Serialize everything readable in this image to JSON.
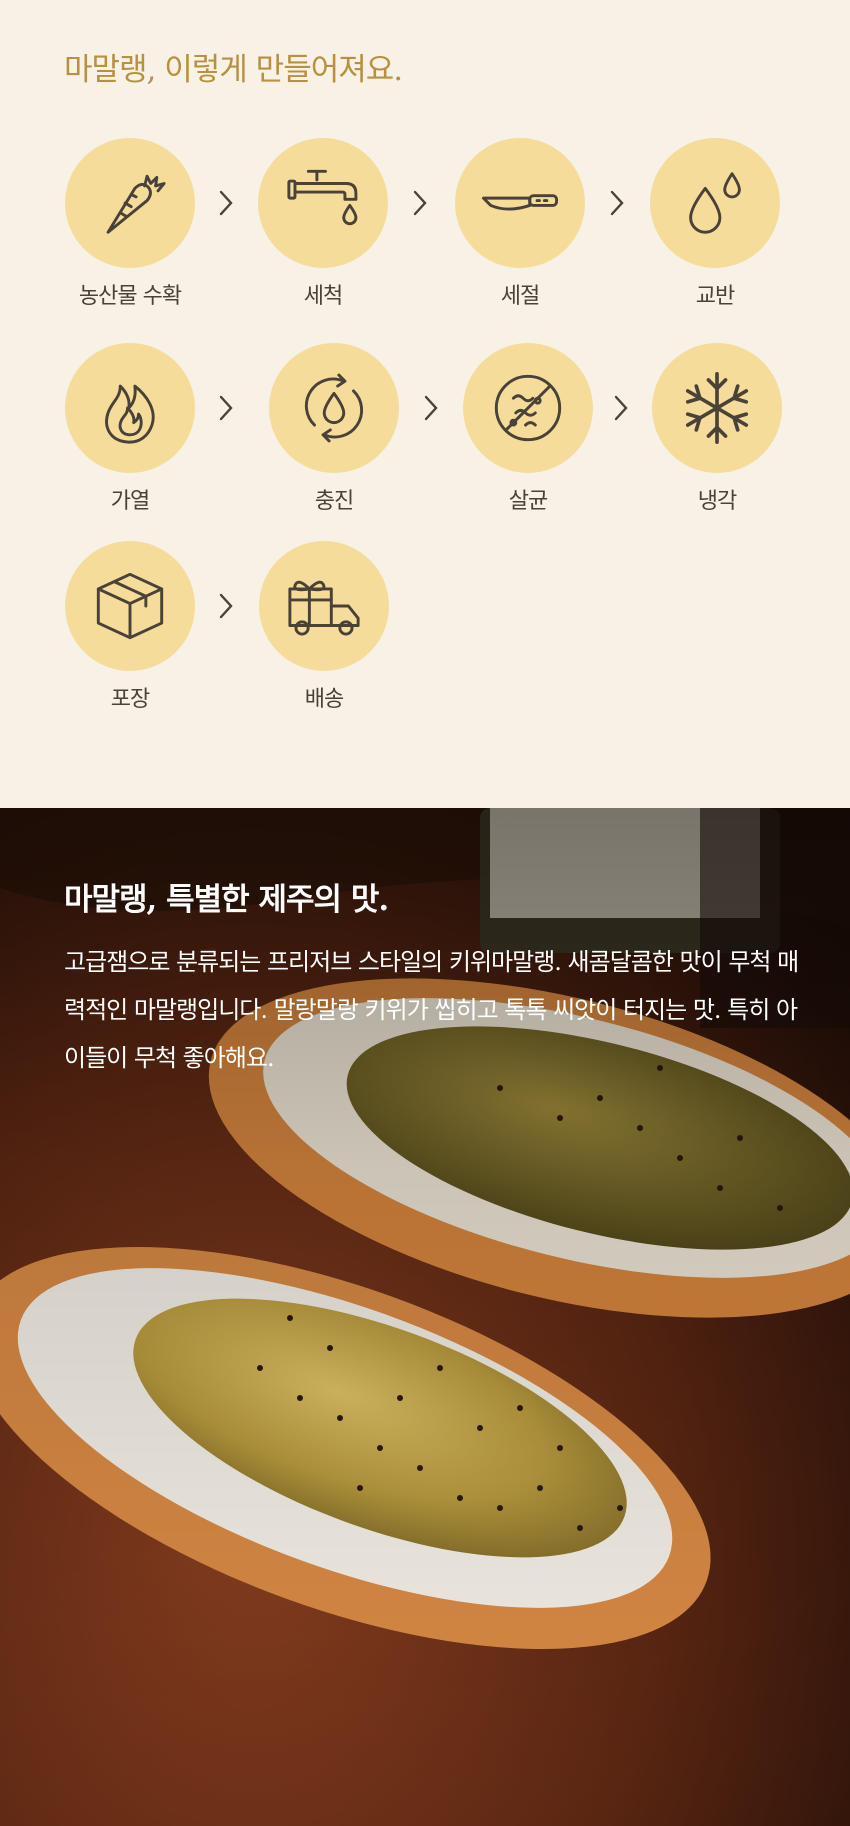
{
  "process": {
    "title": "마말랭, 이렇게 만들어져요.",
    "steps": [
      {
        "label": "농산물 수확",
        "icon": "carrot-icon"
      },
      {
        "label": "세척",
        "icon": "faucet-icon"
      },
      {
        "label": "세절",
        "icon": "knife-icon"
      },
      {
        "label": "교반",
        "icon": "droplets-icon"
      },
      {
        "label": "가열",
        "icon": "flame-icon"
      },
      {
        "label": "충진",
        "icon": "refill-cycle-icon"
      },
      {
        "label": "살균",
        "icon": "no-germs-icon"
      },
      {
        "label": "냉각",
        "icon": "snowflake-icon"
      },
      {
        "label": "포장",
        "icon": "box-icon"
      },
      {
        "label": "배송",
        "icon": "gift-truck-icon"
      }
    ],
    "arrow_icon": "chevron-right-icon"
  },
  "story": {
    "title": "마말랭, 특별한 제주의 맛.",
    "body": "고급잼으로 분류되는 프리저브 스타일의 키위마말랭. 새콤달콤한 맛이 무척 매력적인 마말랭입니다. 말랑말랑 키위가 씹히고 톡톡 씨앗이 터지는 맛. 특히 아이들이 무척 좋아해요.",
    "image": "kiwi-jam-on-baguette-photo"
  },
  "colors": {
    "background": "#f8f1e6",
    "accent": "#b8913f",
    "circle": "#f6dc9b",
    "icon": "#4a4238"
  }
}
